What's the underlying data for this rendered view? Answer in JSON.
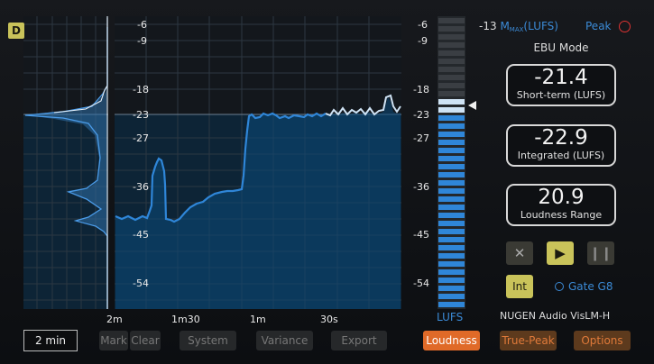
{
  "app": {
    "badge": "D",
    "brand": "NUGEN Audio VisLM-H"
  },
  "scale_left_labels": [
    "-6",
    "-9",
    "-18",
    "-23",
    "-27",
    "-36",
    "-45",
    "-54"
  ],
  "scale_right_labels": [
    "-6",
    "-9",
    "-18",
    "-23",
    "-27",
    "-36",
    "-45",
    "-54"
  ],
  "time_labels": [
    "2m",
    "1m30",
    "1m",
    "30s"
  ],
  "meter_label": "LUFS",
  "mmax": {
    "value": "-13",
    "label_m": "M",
    "label_sub": "MAX",
    "label_unit": "(LUFS)"
  },
  "peak_label": "Peak",
  "mode_label": "EBU Mode",
  "readouts": {
    "short_term": {
      "value": "-21.4",
      "caption": "Short-term (LUFS)"
    },
    "integrated": {
      "value": "-22.9",
      "caption": "Integrated (LUFS)"
    },
    "range": {
      "value": "20.9",
      "caption": "Loudness Range"
    }
  },
  "transport": {
    "stop": "✕",
    "play": "▶",
    "pause": "❙❙"
  },
  "int_label": "Int",
  "gate_label": "Gate G8",
  "bottom": {
    "time_select": "2 min",
    "mark": "Mark",
    "clear": "Clear",
    "system": "System",
    "variance": "Variance",
    "export": "Export",
    "loudness": "Loudness",
    "true_peak": "True-Peak",
    "options": "Options"
  },
  "colors": {
    "accent_blue": "#3b8ad6",
    "yellow": "#c9c35a",
    "orange": "#e06a28"
  }
}
